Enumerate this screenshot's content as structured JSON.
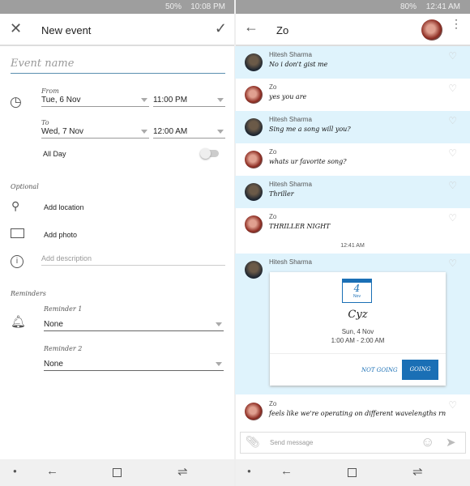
{
  "left": {
    "status": {
      "time": "10:08 PM",
      "battery": "50%"
    },
    "header": {
      "title": "New event",
      "close_icon": "close-icon",
      "confirm_icon": "check-icon"
    },
    "event_name_placeholder": "Event name",
    "from": {
      "label": "From",
      "date": "Tue, 6 Nov",
      "time": "11:00 PM"
    },
    "to": {
      "label": "To",
      "date": "Wed, 7 Nov",
      "time": "12:00 AM"
    },
    "all_day": {
      "label": "All Day",
      "on": false
    },
    "optional_label": "Optional",
    "add_location": "Add location",
    "add_photo": "Add photo",
    "add_description_placeholder": "Add description",
    "reminders_label": "Reminders",
    "reminder1": {
      "label": "Reminder 1",
      "value": "None"
    },
    "reminder2": {
      "label": "Reminder 2",
      "value": "None"
    }
  },
  "right": {
    "status": {
      "time": "12:41 AM",
      "battery": "80%"
    },
    "header": {
      "title": "Zo"
    },
    "messages": [
      {
        "sender": "Hitesh Sharma",
        "text": "No i don't gist me"
      },
      {
        "sender": "Zo",
        "text": "yes you are"
      },
      {
        "sender": "Hitesh Sharma",
        "text": "Sing me a song will  you?"
      },
      {
        "sender": "Zo",
        "text": "whats ur favorite song?"
      },
      {
        "sender": "Hitesh Sharma",
        "text": "Thriller"
      },
      {
        "sender": "Zo",
        "text": "THRILLER NIGHT"
      }
    ],
    "timestamp": "12:41 AM",
    "event_message": {
      "sender": "Hitesh Sharma",
      "day": "4",
      "month": "Nov",
      "title": "Cyz",
      "date": "Sun, 4 Nov",
      "time": "1:00 AM - 2:00 AM",
      "not_going": "NOT GOING",
      "going": "GOING"
    },
    "last_message": {
      "sender": "Zo",
      "text": "feels like we're operating on different wavelengths rn"
    },
    "input_placeholder": "Send message"
  },
  "colors": {
    "accent": "#1a6fb5",
    "highlight": "#dff3fc"
  }
}
